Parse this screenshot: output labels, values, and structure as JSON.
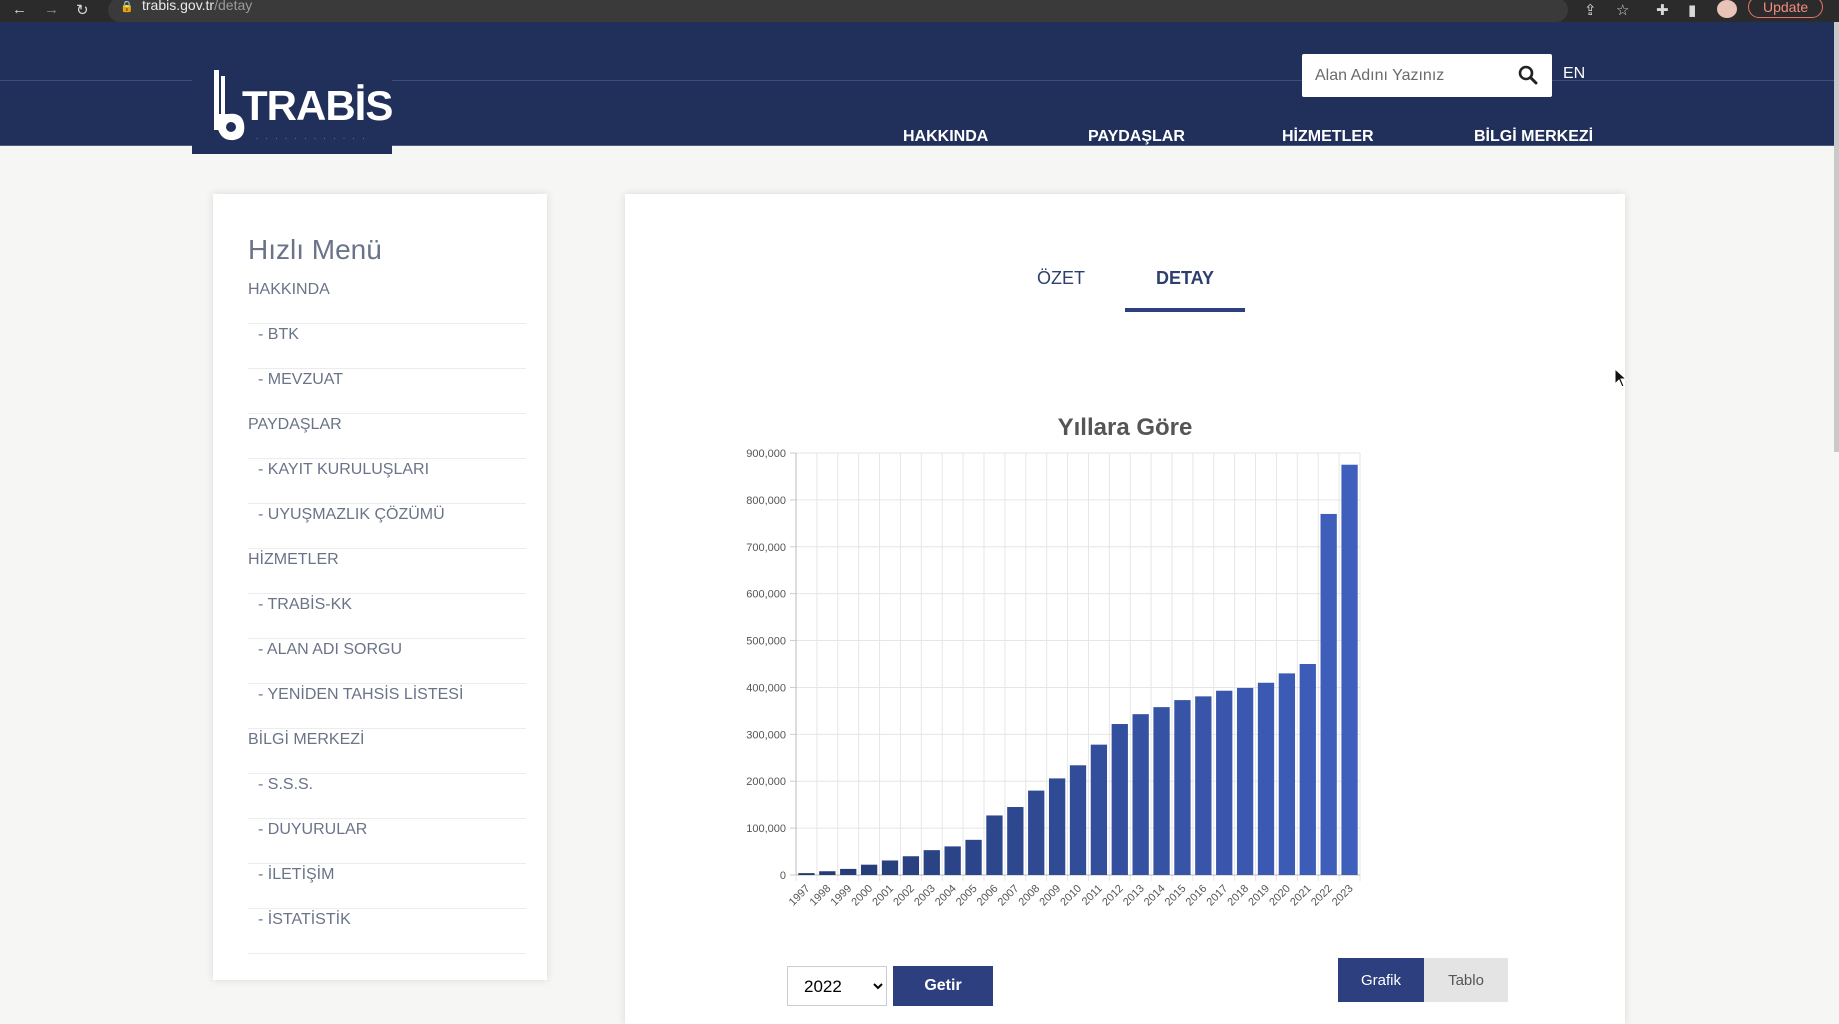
{
  "browser": {
    "url_host": "trabis.gov.tr",
    "url_path": "/detay",
    "update_label": "Update"
  },
  "header": {
    "logo_text": "TRABİS",
    "search": {
      "placeholder": "Alan Adını Yazınız",
      "value": ""
    },
    "lang": "EN",
    "nav": [
      "HAKKINDA",
      "PAYDAŞLAR",
      "HİZMETLER",
      "BİLGİ MERKEZİ"
    ]
  },
  "sidebar": {
    "title": "Hızlı Menü",
    "items": [
      {
        "label": "HAKKINDA",
        "child": false
      },
      {
        "label": "- BTK",
        "child": true
      },
      {
        "label": "- MEVZUAT",
        "child": true
      },
      {
        "label": "PAYDAŞLAR",
        "child": false
      },
      {
        "label": "- KAYIT KURULUŞLARI",
        "child": true
      },
      {
        "label": "- UYUŞMAZLIK ÇÖZÜMÜ",
        "child": true
      },
      {
        "label": "HİZMETLER",
        "child": false
      },
      {
        "label": "- TRABİS-KK",
        "child": true
      },
      {
        "label": "- ALAN ADI SORGU",
        "child": true
      },
      {
        "label": "- YENİDEN TAHSİS LİSTESİ",
        "child": true
      },
      {
        "label": "BİLGİ MERKEZİ",
        "child": false
      },
      {
        "label": "- S.S.S.",
        "child": true
      },
      {
        "label": "- DUYURULAR",
        "child": true
      },
      {
        "label": "- İLETİŞİM",
        "child": true
      },
      {
        "label": "- İSTATİSTİK",
        "child": true
      }
    ]
  },
  "tabs": {
    "ozet": "ÖZET",
    "detay": "DETAY",
    "active": "DETAY"
  },
  "controls": {
    "year_options": [
      "2022"
    ],
    "year_selected": "2022",
    "getir_label": "Getir",
    "grafik_label": "Grafik",
    "tablo_label": "Tablo",
    "view_active": "Grafik"
  },
  "colors": {
    "navy": "#20305b",
    "accent": "#2d3f7e",
    "bar_dark": "#243a73",
    "bar_light": "#3f5fbd"
  },
  "chart_data": {
    "type": "bar",
    "title": "Yıllara Göre",
    "categories": [
      "1997",
      "1998",
      "1999",
      "2000",
      "2001",
      "2002",
      "2003",
      "2004",
      "2005",
      "2006",
      "2007",
      "2008",
      "2009",
      "2010",
      "2011",
      "2012",
      "2013",
      "2014",
      "2015",
      "2016",
      "2017",
      "2018",
      "2019",
      "2020",
      "2021",
      "2022",
      "2023"
    ],
    "values": [
      4000,
      8000,
      13000,
      22000,
      31000,
      40000,
      53000,
      61000,
      75000,
      127000,
      145000,
      180000,
      206000,
      234000,
      278000,
      322000,
      343000,
      358000,
      373000,
      381000,
      393000,
      399000,
      410000,
      430000,
      450000,
      770000,
      875000
    ],
    "ylim": [
      0,
      900000
    ],
    "yticks": [
      0,
      100000,
      200000,
      300000,
      400000,
      500000,
      600000,
      700000,
      800000,
      900000
    ],
    "ytick_labels": [
      "0",
      "100,000",
      "200,000",
      "300,000",
      "400,000",
      "500,000",
      "600,000",
      "700,000",
      "800,000",
      "900,000"
    ],
    "grid": true,
    "xlabel": "",
    "ylabel": ""
  }
}
